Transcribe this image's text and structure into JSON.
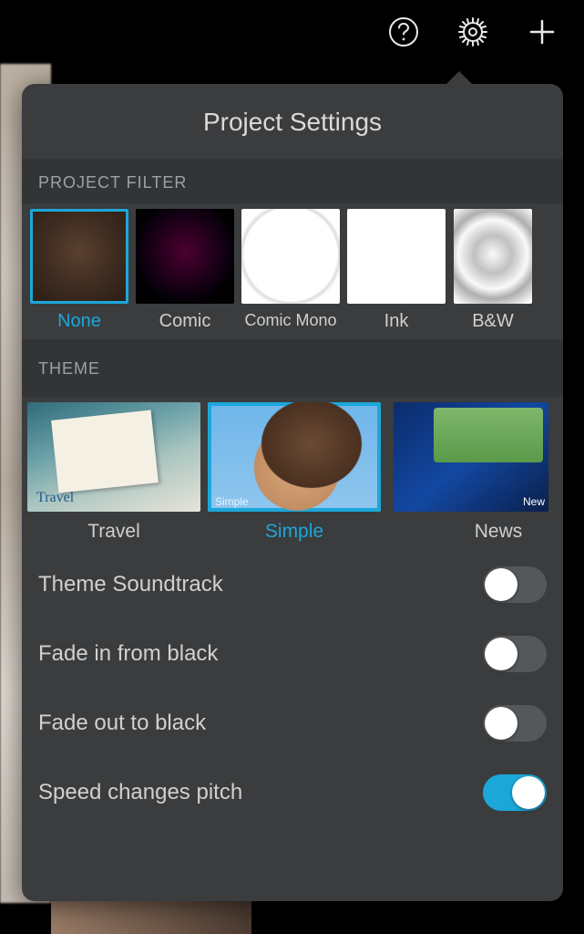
{
  "title": "Project Settings",
  "sections": {
    "filter_header": "PROJECT FILTER",
    "theme_header": "THEME"
  },
  "filters": [
    {
      "label": "None",
      "selected": true
    },
    {
      "label": "Comic",
      "selected": false
    },
    {
      "label": "Comic Mono",
      "selected": false
    },
    {
      "label": "Ink",
      "selected": false
    },
    {
      "label": "B&W",
      "selected": false
    }
  ],
  "themes": [
    {
      "label": "Travel",
      "selected": false
    },
    {
      "label": "Simple",
      "selected": true
    },
    {
      "label": "News",
      "selected": false
    }
  ],
  "settings": [
    {
      "label": "Theme Soundtrack",
      "on": false
    },
    {
      "label": "Fade in from black",
      "on": false
    },
    {
      "label": "Fade out to black",
      "on": false
    },
    {
      "label": "Speed changes pitch",
      "on": true
    }
  ]
}
